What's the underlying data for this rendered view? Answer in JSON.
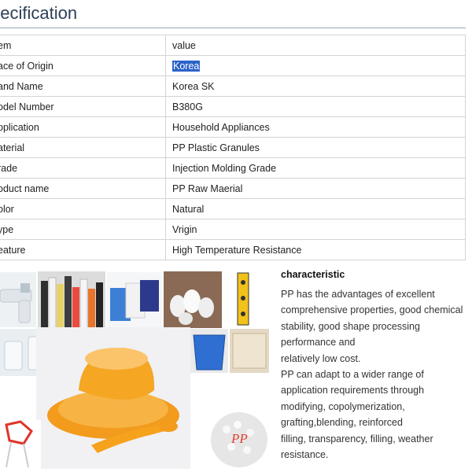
{
  "title": "pecification",
  "table": {
    "header": {
      "item": "em",
      "value": "value"
    },
    "rows": [
      {
        "item": "ace of Origin",
        "value": "Korea"
      },
      {
        "item": "and Name",
        "value": "Korea SK"
      },
      {
        "item": "odel Number",
        "value": "B380G"
      },
      {
        "item": "pplication",
        "value": "Household Appliances"
      },
      {
        "item": "aterial",
        "value": "PP Plastic Granules"
      },
      {
        "item": "rade",
        "value": "Injection Molding Grade"
      },
      {
        "item": "oduct name",
        "value": "PP Raw Maerial"
      },
      {
        "item": "olor",
        "value": "Natural"
      },
      {
        "item": "ype",
        "value": "Vrigin"
      },
      {
        "item": "eature",
        "value": "High Temperature Resistance"
      }
    ]
  },
  "side": {
    "heading": "characteristic",
    "lines": [
      "PP has the advantages of excellent",
      "comprehensive properties, good chemical",
      "stability, good shape processing",
      "performance and",
      "relatively low cost.",
      "PP can adapt to a wider range of",
      "application requirements through",
      "modifying, copolymerization,",
      "grafting,blending, reinforced",
      "filling, transparency, filling, weather",
      "resistance."
    ]
  },
  "collage": {
    "badge": "PP"
  },
  "colors": {
    "title": "#2b3f57",
    "selection": "#2b63c9",
    "orange": "#f5a623"
  }
}
